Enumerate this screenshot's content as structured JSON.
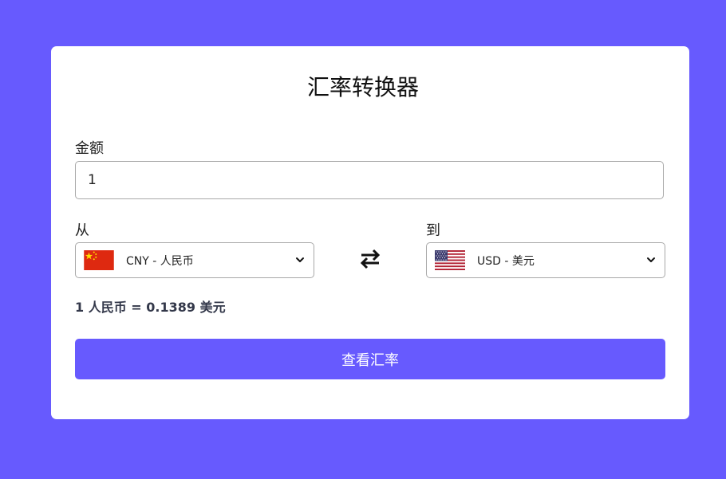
{
  "title": "汇率转换器",
  "amount": {
    "label": "金额",
    "value": "1"
  },
  "from": {
    "label": "从",
    "currency": "CNY - 人民币",
    "flag": "china-flag-icon"
  },
  "to": {
    "label": "到",
    "currency": "USD - 美元",
    "flag": "usa-flag-icon"
  },
  "swap_icon": "swap-arrows-icon",
  "rate_text": "1 人民币 = 0.1389 美元",
  "button_label": "查看汇率",
  "colors": {
    "background": "#675afe",
    "card": "#ffffff",
    "button": "#675afe",
    "rate_text": "#33384a"
  }
}
